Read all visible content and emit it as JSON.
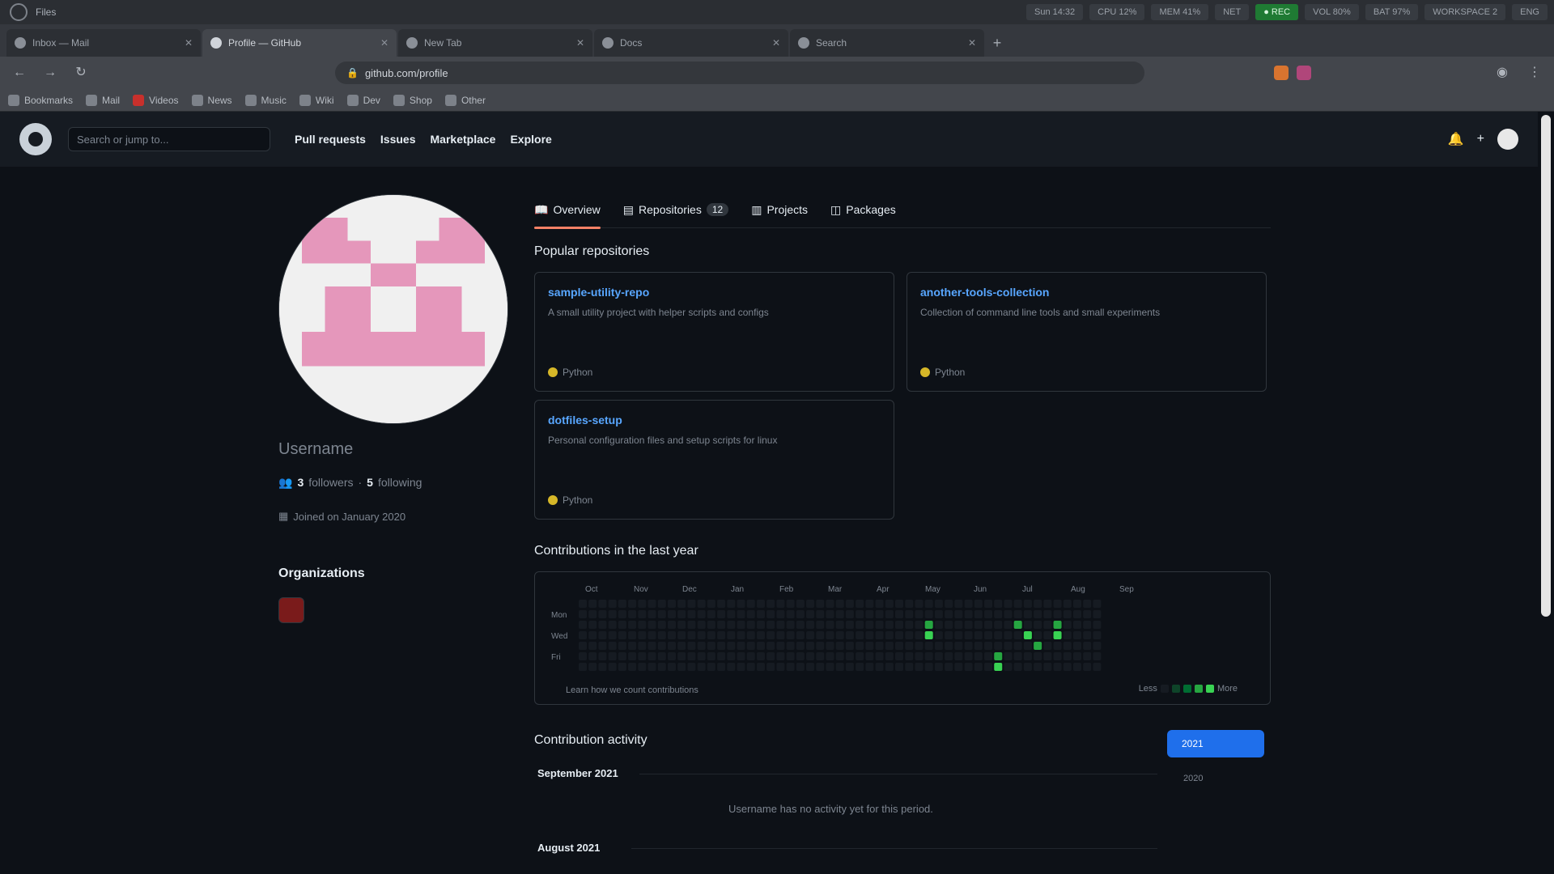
{
  "os_bar": {
    "app_name": "Files",
    "widgets": [
      "Sun 14:32",
      "CPU 12%",
      "MEM 41%",
      "NET",
      "● REC",
      "VOL 80%",
      "BAT 97%",
      "WORKSPACE 2",
      "ENG"
    ]
  },
  "browser": {
    "tabs": [
      {
        "label": "Inbox — Mail"
      },
      {
        "label": "Profile — GitHub"
      },
      {
        "label": "New Tab"
      },
      {
        "label": "Docs"
      },
      {
        "label": "Search"
      }
    ],
    "new_tab_label": "+",
    "url": "github.com/profile",
    "bookmarks": [
      "Bookmarks",
      "Mail",
      "Videos",
      "News",
      "Music",
      "Wiki",
      "Dev",
      "Shop",
      "Other"
    ]
  },
  "github": {
    "search_placeholder": "Search or jump to...",
    "nav": [
      "Pull requests",
      "Issues",
      "Marketplace",
      "Explore"
    ],
    "profile": {
      "name": "Username",
      "followers_count": "3",
      "followers_label": "followers",
      "following_count": "5",
      "following_label": "following",
      "joined": "Joined on January 2020",
      "organizations_title": "Organizations"
    },
    "tabs": [
      {
        "label": "Overview",
        "count": ""
      },
      {
        "label": "Repositories",
        "count": "12"
      },
      {
        "label": "Projects",
        "count": ""
      },
      {
        "label": "Packages",
        "count": ""
      }
    ],
    "popular_title": "Popular repositories",
    "pinned": [
      {
        "repo": "sample-utility-repo",
        "desc": "A small utility project with helper scripts and configs",
        "lang": "Python"
      },
      {
        "repo": "another-tools-collection",
        "desc": "Collection of command line tools and small experiments",
        "lang": "Python"
      },
      {
        "repo": "dotfiles-setup",
        "desc": "Personal configuration files and setup scripts for linux",
        "lang": "Python"
      }
    ],
    "contrib_title": "Contributions in the last year",
    "contrib_months": [
      "Oct",
      "Nov",
      "Dec",
      "Jan",
      "Feb",
      "Mar",
      "Apr",
      "May",
      "Jun",
      "Jul",
      "Aug",
      "Sep"
    ],
    "contrib_days": [
      "Mon",
      "Wed",
      "Fri"
    ],
    "contrib_footer": "Learn how we count contributions",
    "legend_less": "Less",
    "legend_more": "More",
    "activity_title": "Contribution activity",
    "year_button": "2021",
    "year_small": "2020",
    "activity_month_1": "September 2021",
    "activity_empty": "Username has no activity yet for this period.",
    "activity_month_2": "August 2021"
  },
  "colors": {
    "accent": "#58a6ff",
    "tab_underline": "#f78166",
    "contrib_level_1": "#0e4429",
    "contrib_level_2": "#006d32",
    "contrib_level_3": "#26a641",
    "contrib_level_4": "#39d353"
  }
}
